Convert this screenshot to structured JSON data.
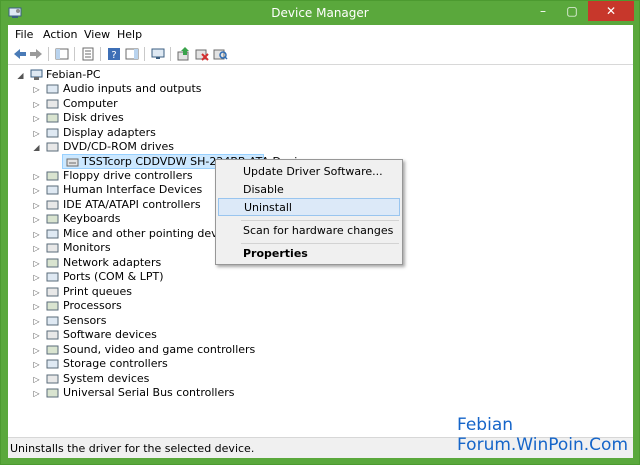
{
  "window": {
    "title": "Device Manager",
    "controls": {
      "minimize": "–",
      "maximize": "▢",
      "close": "✕"
    }
  },
  "menu": {
    "items": [
      "File",
      "Action",
      "View",
      "Help"
    ]
  },
  "toolbar": {
    "buttons": [
      "back-icon",
      "forward-icon",
      "console-tree-icon",
      "properties-icon",
      "help-icon",
      "action-pane-icon",
      "monitor-icon",
      "update-driver-icon",
      "disable-device-icon",
      "scan-hardware-icon"
    ]
  },
  "tree": {
    "root": "Febian-PC",
    "categories": [
      "Audio inputs and outputs",
      "Computer",
      "Disk drives",
      "Display adapters",
      "DVD/CD-ROM drives",
      "Floppy drive controllers",
      "Human Interface Devices",
      "IDE ATA/ATAPI controllers",
      "Keyboards",
      "Mice and other pointing devices",
      "Monitors",
      "Network adapters",
      "Ports (COM & LPT)",
      "Print queues",
      "Processors",
      "Sensors",
      "Software devices",
      "Sound, video and game controllers",
      "Storage controllers",
      "System devices",
      "Universal Serial Bus controllers"
    ],
    "selected_device": "TSSTcorp CDDVDW SH-224BB ATA Device",
    "expanded_category": "DVD/CD-ROM drives"
  },
  "context_menu": {
    "items": [
      "Update Driver Software...",
      "Disable",
      "Uninstall",
      "Scan for hardware changes",
      "Properties"
    ],
    "highlighted": "Uninstall"
  },
  "status": {
    "text": "Uninstalls the driver for the selected device."
  },
  "watermark": {
    "line1": "Febian",
    "line2": "Forum.WinPoin.Com"
  },
  "colors": {
    "titlebar": "#5aa83c",
    "close": "#c7372b",
    "selection": "#cce8ff",
    "menu_hover": "#dce9f8",
    "watermark": "#1565c9"
  }
}
